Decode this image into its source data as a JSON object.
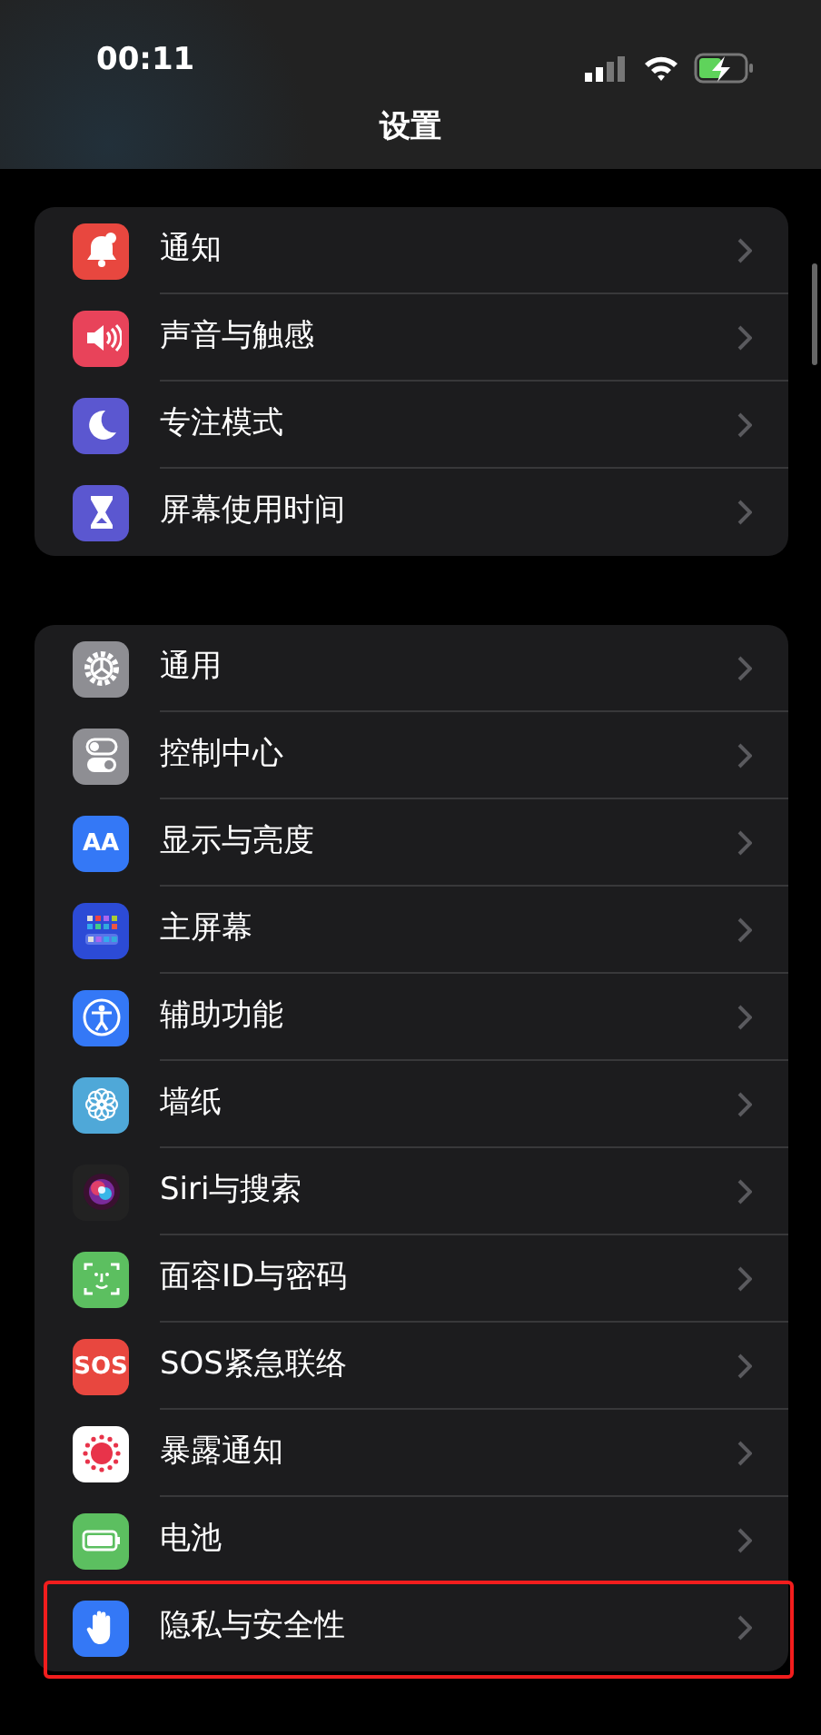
{
  "status_bar": {
    "time": "00:11"
  },
  "title": "设置",
  "groups": [
    {
      "items": [
        {
          "label": "通知",
          "kind": "bell",
          "color": "#e8473f",
          "highlighted": false
        },
        {
          "label": "声音与触感",
          "kind": "speaker",
          "color": "#e8435a",
          "highlighted": false
        },
        {
          "label": "专注模式",
          "kind": "moon",
          "color": "#5b57d0",
          "highlighted": false
        },
        {
          "label": "屏幕使用时间",
          "kind": "hourglass",
          "color": "#5b57d0",
          "highlighted": false
        }
      ]
    },
    {
      "items": [
        {
          "label": "通用",
          "kind": "gear",
          "color": "#8e8e93",
          "highlighted": false
        },
        {
          "label": "控制中心",
          "kind": "toggles",
          "color": "#8e8e93",
          "highlighted": false
        },
        {
          "label": "显示与亮度",
          "kind": "text",
          "icon_text": "AA",
          "color": "#3478f6",
          "highlighted": false
        },
        {
          "label": "主屏幕",
          "kind": "grid",
          "color": "#2c4bd6",
          "highlighted": false
        },
        {
          "label": "辅助功能",
          "kind": "person",
          "color": "#3478f6",
          "highlighted": false
        },
        {
          "label": "墙纸",
          "kind": "flower",
          "color": "#4fa8d8",
          "highlighted": false
        },
        {
          "label": "Siri与搜索",
          "kind": "orb",
          "color": "#222222",
          "highlighted": false
        },
        {
          "label": "面容ID与密码",
          "kind": "face",
          "color": "#5cbf60",
          "highlighted": false
        },
        {
          "label": "SOS紧急联络",
          "kind": "text",
          "icon_text": "SOS",
          "color": "#e8473f",
          "highlighted": false
        },
        {
          "label": "暴露通知",
          "kind": "sun",
          "color": "#ffffff",
          "highlighted": false
        },
        {
          "label": "电池",
          "kind": "battery",
          "color": "#5cbf60",
          "highlighted": false
        },
        {
          "label": "隐私与安全性",
          "kind": "hand",
          "color": "#3478f6",
          "highlighted": true
        }
      ]
    }
  ]
}
